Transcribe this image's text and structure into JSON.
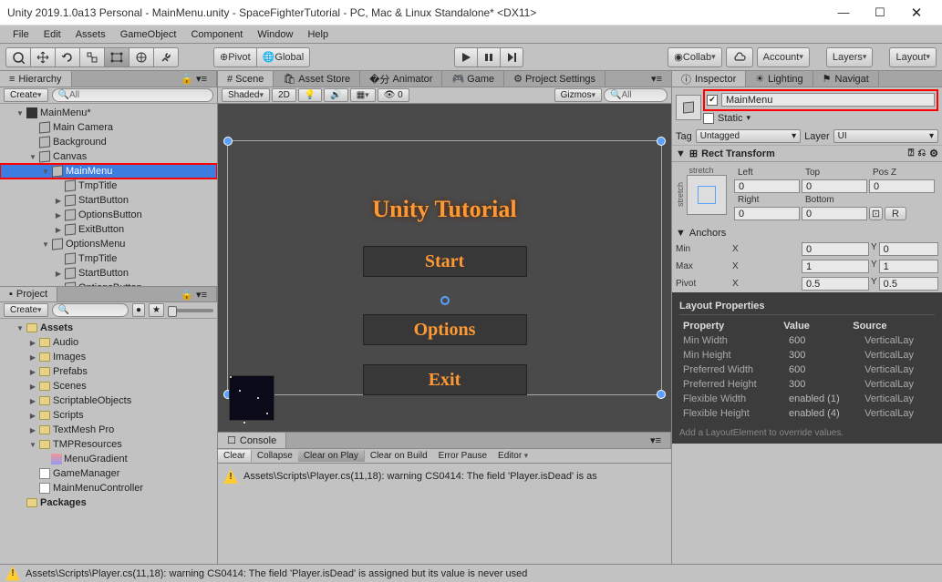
{
  "window": {
    "title": "Unity 2019.1.0a13 Personal - MainMenu.unity - SpaceFighterTutorial - PC, Mac & Linux Standalone* <DX11>",
    "minimize": "—",
    "maximize": "☐",
    "close": "✕"
  },
  "menubar": [
    "File",
    "Edit",
    "Assets",
    "GameObject",
    "Component",
    "Window",
    "Help"
  ],
  "toolbar": {
    "pivot": "Pivot",
    "global": "Global",
    "collab": "Collab",
    "account": "Account",
    "layers": "Layers",
    "layout": "Layout"
  },
  "hierarchy": {
    "tab": "Hierarchy",
    "create": "Create",
    "search_placeholder": "All",
    "items": [
      {
        "label": "MainMenu*",
        "depth": 1,
        "icon": "unity",
        "expanded": true
      },
      {
        "label": "Main Camera",
        "depth": 2,
        "icon": "cube"
      },
      {
        "label": "Background",
        "depth": 2,
        "icon": "cube"
      },
      {
        "label": "Canvas",
        "depth": 2,
        "icon": "cube",
        "expanded": true
      },
      {
        "label": "MainMenu",
        "depth": 3,
        "icon": "cube",
        "expanded": true,
        "selected": true,
        "boxed": true
      },
      {
        "label": "TmpTitle",
        "depth": 4,
        "icon": "cube"
      },
      {
        "label": "StartButton",
        "depth": 4,
        "icon": "cube",
        "expanded": false
      },
      {
        "label": "OptionsButton",
        "depth": 4,
        "icon": "cube",
        "expanded": false
      },
      {
        "label": "ExitButton",
        "depth": 4,
        "icon": "cube",
        "expanded": false
      },
      {
        "label": "OptionsMenu",
        "depth": 3,
        "icon": "cube",
        "expanded": true
      },
      {
        "label": "TmpTitle",
        "depth": 4,
        "icon": "cube"
      },
      {
        "label": "StartButton",
        "depth": 4,
        "icon": "cube",
        "expanded": false
      },
      {
        "label": "OptionsButton",
        "depth": 4,
        "icon": "cube",
        "expanded": false
      }
    ]
  },
  "project": {
    "tab": "Project",
    "create": "Create",
    "items": [
      {
        "label": "Assets",
        "depth": 0,
        "icon": "folder",
        "expanded": true,
        "bold": true
      },
      {
        "label": "Audio",
        "depth": 1,
        "icon": "folder"
      },
      {
        "label": "Images",
        "depth": 1,
        "icon": "folder"
      },
      {
        "label": "Prefabs",
        "depth": 1,
        "icon": "folder"
      },
      {
        "label": "Scenes",
        "depth": 1,
        "icon": "folder"
      },
      {
        "label": "ScriptableObjects",
        "depth": 1,
        "icon": "folder"
      },
      {
        "label": "Scripts",
        "depth": 1,
        "icon": "folder"
      },
      {
        "label": "TextMesh Pro",
        "depth": 1,
        "icon": "folder"
      },
      {
        "label": "TMPResources",
        "depth": 1,
        "icon": "folder",
        "expanded": true
      },
      {
        "label": "MenuGradient",
        "depth": 2,
        "icon": "asset"
      },
      {
        "label": "GameManager",
        "depth": 1,
        "icon": "cs"
      },
      {
        "label": "MainMenuController",
        "depth": 1,
        "icon": "cs"
      },
      {
        "label": "Packages",
        "depth": 0,
        "icon": "folder",
        "bold": true
      }
    ]
  },
  "scene": {
    "tabs": [
      {
        "label": "Scene",
        "active": true,
        "icon": "scene"
      },
      {
        "label": "Asset Store",
        "icon": "store"
      },
      {
        "label": "Animator",
        "icon": "anim"
      },
      {
        "label": "Game",
        "icon": "game"
      },
      {
        "label": "Project Settings",
        "icon": "gear"
      }
    ],
    "toolbar": {
      "shaded": "Shaded",
      "mode_2d": "2D",
      "gizmos": "Gizmos",
      "search_placeholder": "All"
    },
    "game_title": "Unity Tutorial",
    "buttons": [
      "Start",
      "Options",
      "Exit"
    ]
  },
  "console": {
    "tab": "Console",
    "toolbar": [
      "Clear",
      "Collapse",
      "Clear on Play",
      "Clear on Build",
      "Error Pause",
      "Editor"
    ],
    "warning": "Assets\\Scripts\\Player.cs(11,18): warning CS0414: The field 'Player.isDead' is as"
  },
  "inspector": {
    "tabs": [
      {
        "label": "Inspector",
        "active": true
      },
      {
        "label": "Lighting"
      },
      {
        "label": "Navigat"
      }
    ],
    "object_name": "MainMenu",
    "enabled": true,
    "static_label": "Static",
    "tag_label": "Tag",
    "tag_value": "Untagged",
    "layer_label": "Layer",
    "layer_value": "UI",
    "rect_transform": {
      "title": "Rect Transform",
      "stretch": "stretch",
      "left_label": "Left",
      "left": "0",
      "top_label": "Top",
      "top": "0",
      "posz_label": "Pos Z",
      "posz": "0",
      "right_label": "Right",
      "right": "0",
      "bottom_label": "Bottom",
      "bottom": "0",
      "anchors_label": "Anchors",
      "min_label": "Min",
      "min_x": "0",
      "min_y": "0",
      "max_label": "Max",
      "max_x": "1",
      "max_y": "1",
      "pivot_label": "Pivot",
      "pivot_x": "0.5",
      "pivot_y": "0.5",
      "r_button": "R"
    },
    "layout": {
      "title": "Layout Properties",
      "col_property": "Property",
      "col_value": "Value",
      "col_source": "Source",
      "rows": [
        {
          "prop": "Min Width",
          "val": "600",
          "src": "VerticalLay"
        },
        {
          "prop": "Min Height",
          "val": "300",
          "src": "VerticalLay"
        },
        {
          "prop": "Preferred Width",
          "val": "600",
          "src": "VerticalLay"
        },
        {
          "prop": "Preferred Height",
          "val": "300",
          "src": "VerticalLay"
        },
        {
          "prop": "Flexible Width",
          "val": "enabled (1)",
          "src": "VerticalLay"
        },
        {
          "prop": "Flexible Height",
          "val": "enabled (4)",
          "src": "VerticalLay"
        }
      ],
      "note": "Add a LayoutElement to override values."
    }
  },
  "statusbar": {
    "warning": "Assets\\Scripts\\Player.cs(11,18): warning CS0414: The field 'Player.isDead' is assigned but its value is never used"
  }
}
